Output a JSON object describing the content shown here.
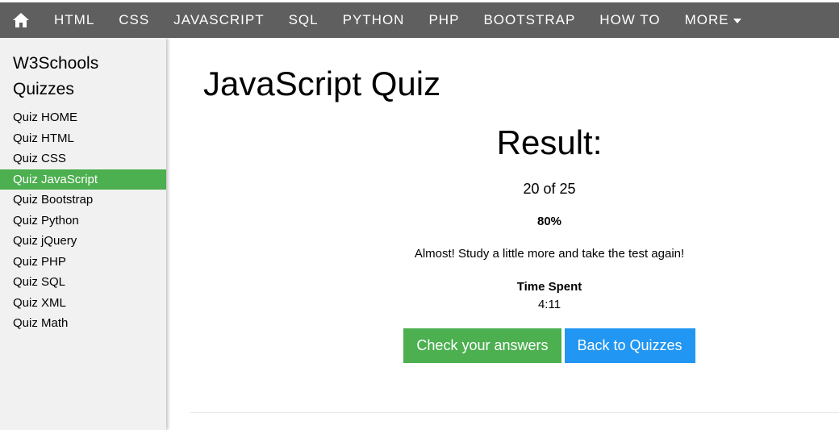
{
  "topnav": {
    "home_icon": "home-icon",
    "items": [
      "HTML",
      "CSS",
      "JAVASCRIPT",
      "SQL",
      "PYTHON",
      "PHP",
      "BOOTSTRAP",
      "HOW TO"
    ],
    "more_label": "MORE",
    "more_icon": "caret-down-icon"
  },
  "sidebar": {
    "title_line1": "W3Schools",
    "title_line2": "Quizzes",
    "items": [
      "Quiz HOME",
      "Quiz HTML",
      "Quiz CSS",
      "Quiz JavaScript",
      "Quiz Bootstrap",
      "Quiz Python",
      "Quiz jQuery",
      "Quiz PHP",
      "Quiz SQL",
      "Quiz XML",
      "Quiz Math"
    ],
    "active_item": "Quiz JavaScript"
  },
  "main": {
    "title": "JavaScript Quiz",
    "result": {
      "heading": "Result:",
      "score": "20 of 25",
      "percent": "80%",
      "message": "Almost! Study a little more and take the test again!",
      "time_label": "Time Spent",
      "time_value": "4:11"
    },
    "buttons": {
      "check_answers": "Check your answers",
      "back_to_quizzes": "Back to Quizzes"
    }
  },
  "colors": {
    "topbar": "#5f5f5f",
    "sidebar": "#f1f1f1",
    "active_green": "#4caf50",
    "blue": "#2196f3"
  }
}
